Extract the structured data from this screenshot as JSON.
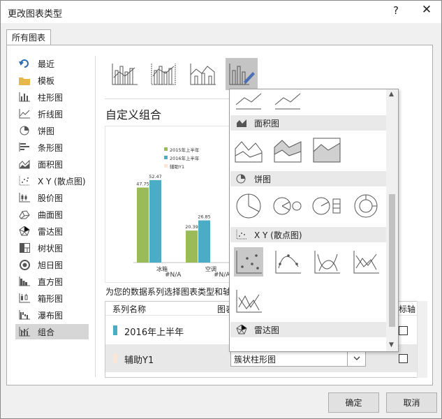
{
  "window": {
    "title": "更改图表类型",
    "help": "?",
    "close": "✕"
  },
  "tab": {
    "label": "所有图表"
  },
  "sidebar": {
    "items": [
      {
        "label": "最近",
        "icon": "recent-icon"
      },
      {
        "label": "模板",
        "icon": "folder-icon"
      },
      {
        "label": "柱形图",
        "icon": "column-chart-icon"
      },
      {
        "label": "折线图",
        "icon": "line-chart-icon"
      },
      {
        "label": "饼图",
        "icon": "pie-chart-icon"
      },
      {
        "label": "条形图",
        "icon": "bar-chart-icon"
      },
      {
        "label": "面积图",
        "icon": "area-chart-icon"
      },
      {
        "label": "X Y (散点图)",
        "icon": "scatter-chart-icon"
      },
      {
        "label": "股价图",
        "icon": "stock-chart-icon"
      },
      {
        "label": "曲面图",
        "icon": "surface-chart-icon"
      },
      {
        "label": "雷达图",
        "icon": "radar-chart-icon"
      },
      {
        "label": "树状图",
        "icon": "treemap-chart-icon"
      },
      {
        "label": "旭日图",
        "icon": "sunburst-chart-icon"
      },
      {
        "label": "直方图",
        "icon": "histogram-chart-icon"
      },
      {
        "label": "箱形图",
        "icon": "box-chart-icon"
      },
      {
        "label": "瀑布图",
        "icon": "waterfall-chart-icon"
      },
      {
        "label": "组合",
        "icon": "combo-chart-icon",
        "selected": true
      }
    ]
  },
  "main": {
    "section_title": "自定义组合",
    "caption": "为您的数据系列选择图表类型和轴",
    "grid": {
      "headers": [
        "系列名称",
        "图表",
        "标轴"
      ],
      "rows": [
        {
          "name": "2016年上半年",
          "color": "#4bacc6"
        },
        {
          "name": "辅助Y1",
          "color": "#fbe5d6",
          "chart_type": "簇状柱形图"
        }
      ]
    }
  },
  "dropdown": {
    "sections": [
      {
        "label": "面积图"
      },
      {
        "label": "饼图"
      },
      {
        "label": "X Y (散点图)"
      },
      {
        "label": "雷达图"
      }
    ]
  },
  "buttons": {
    "ok": "确定",
    "cancel": "取消"
  },
  "chart_data": {
    "type": "bar",
    "categories": [
      "冰箱",
      "空调"
    ],
    "series": [
      {
        "name": "2015年上半年",
        "color": "#9bbb59",
        "values": [
          47.75,
          20.39
        ]
      },
      {
        "name": "2016年上半年",
        "color": "#4bacc6",
        "values": [
          52.47,
          26.85
        ]
      },
      {
        "name": "辅助Y1",
        "color": "#fbe5d6",
        "values": [
          "#N/A",
          "#N/A"
        ]
      }
    ],
    "ylim": [
      0,
      60
    ],
    "legend": "top"
  }
}
